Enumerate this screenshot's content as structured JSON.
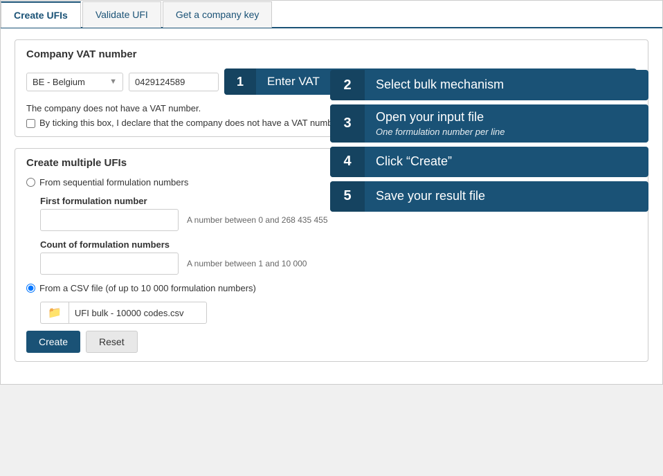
{
  "tabs": [
    {
      "label": "Create UFIs",
      "active": true
    },
    {
      "label": "Validate UFI",
      "active": false
    },
    {
      "label": "Get a company key",
      "active": false
    }
  ],
  "vat_section": {
    "title": "Company VAT number",
    "country_value": "BE - Belgium",
    "vat_value": "0429124589",
    "no_vat_text": "The company does not have a VAT number.",
    "checkbox_label": "By ticking this box, I declare that the company does not have a VAT number."
  },
  "bulk_section": {
    "title": "Create multiple UFIs",
    "sequential_label": "From sequential formulation numbers",
    "first_number_label": "First formulation number",
    "first_number_placeholder": "",
    "first_number_hint": "A number between 0 and 268 435 455",
    "count_label": "Count of formulation numbers",
    "count_placeholder": "",
    "count_hint": "A number between 1 and 10 000",
    "csv_label": "From a CSV file (of up to 10 000 formulation numbers)",
    "file_name": "UFI bulk - 10000 codes.csv",
    "create_btn": "Create",
    "reset_btn": "Reset"
  },
  "steps": [
    {
      "number": "1",
      "text": "Enter VAT",
      "sub": ""
    },
    {
      "number": "2",
      "text": "Select bulk mechanism",
      "sub": ""
    },
    {
      "number": "3",
      "text": "Open your input file",
      "sub": "One formulation number per line"
    },
    {
      "number": "4",
      "text": "Click “Create”",
      "sub": ""
    },
    {
      "number": "5",
      "text": "Save your result file",
      "sub": ""
    }
  ]
}
